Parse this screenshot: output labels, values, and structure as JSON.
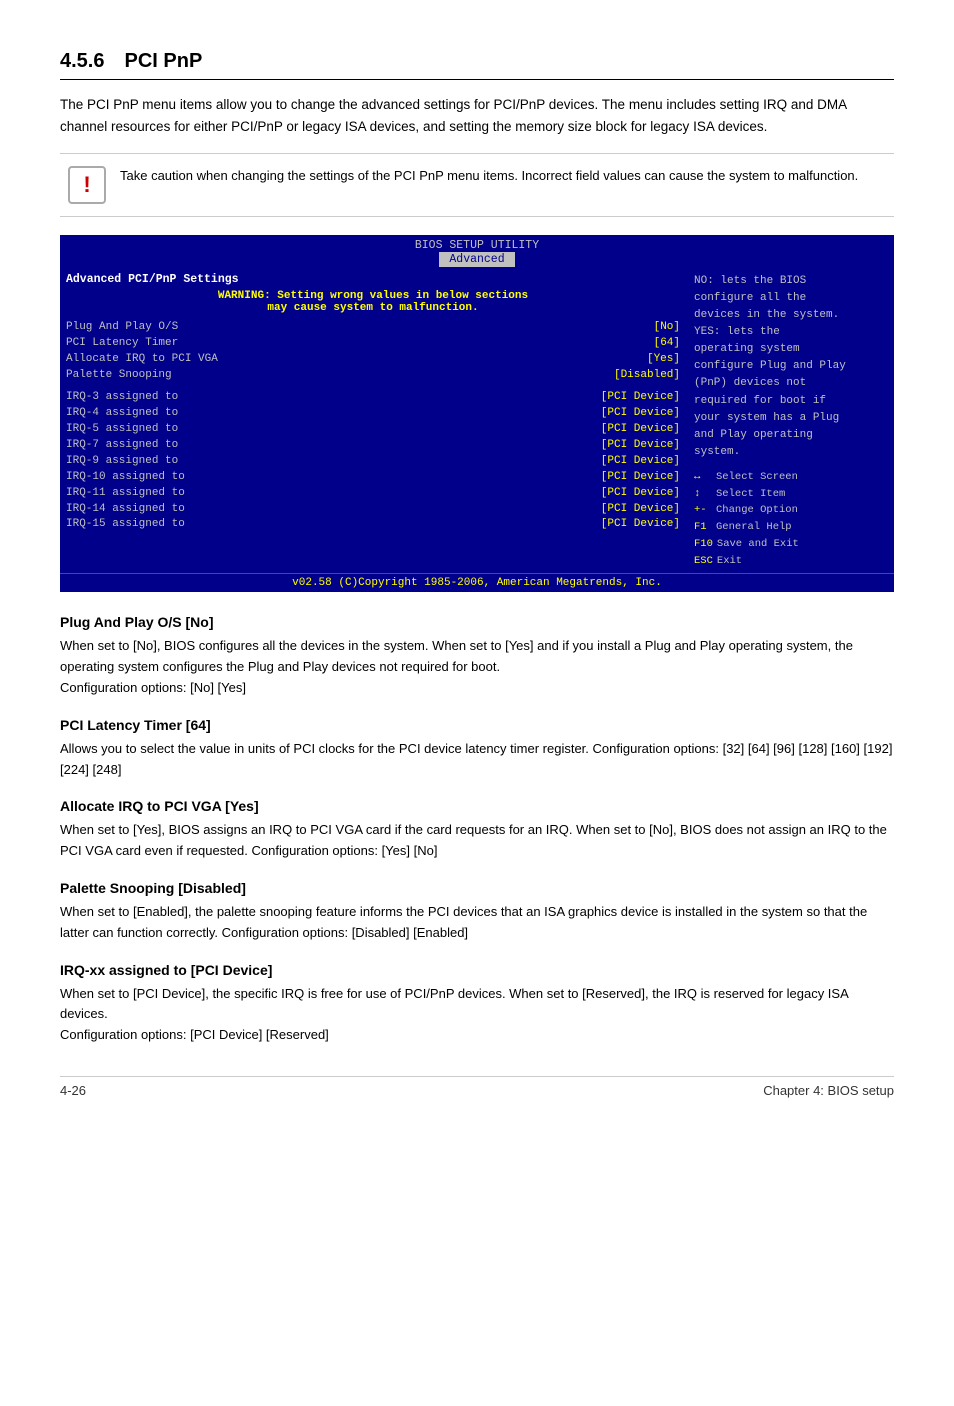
{
  "section": {
    "number": "4.5.6",
    "title": "PCI PnP",
    "intro": "The PCI PnP menu items allow you to change the advanced settings for PCI/PnP devices. The menu includes setting IRQ and DMA channel resources for either PCI/PnP or legacy ISA devices, and setting the memory size block for legacy ISA devices.",
    "warning": "Take caution when changing the settings of the PCI PnP menu items. Incorrect field values can cause the system to malfunction."
  },
  "bios": {
    "title": "BIOS SETUP UTILITY",
    "tab": "Advanced",
    "left": {
      "header": "Advanced PCI/PnP Settings",
      "warning_line1": "WARNING: Setting wrong values in below sections",
      "warning_line2": "may cause system to malfunction.",
      "settings": [
        {
          "key": "Plug And Play O/S",
          "value": "[No]"
        },
        {
          "key": "PCI Latency Timer",
          "value": "[64]"
        },
        {
          "key": "Allocate IRQ to PCI VGA",
          "value": "[Yes]"
        },
        {
          "key": "Palette Snooping",
          "value": "[Disabled]"
        }
      ],
      "irqs": [
        {
          "key": "IRQ-3  assigned to",
          "value": "[PCI Device]"
        },
        {
          "key": "IRQ-4  assigned to",
          "value": "[PCI Device]"
        },
        {
          "key": "IRQ-5  assigned to",
          "value": "[PCI Device]"
        },
        {
          "key": "IRQ-7  assigned to",
          "value": "[PCI Device]"
        },
        {
          "key": "IRQ-9  assigned to",
          "value": "[PCI Device]"
        },
        {
          "key": "IRQ-10 assigned to",
          "value": "[PCI Device]"
        },
        {
          "key": "IRQ-11 assigned to",
          "value": "[PCI Device]"
        },
        {
          "key": "IRQ-14 assigned to",
          "value": "[PCI Device]"
        },
        {
          "key": "IRQ-15 assigned to",
          "value": "[PCI Device]"
        }
      ]
    },
    "right": {
      "description_lines": [
        "NO: lets the BIOS",
        "configure all the",
        "devices in the system.",
        "YES: lets the",
        "operating system",
        "configure Plug and Play",
        "(PnP) devices not",
        "required for boot if",
        "your system has a Plug",
        "and Play operating",
        "system."
      ],
      "keys": [
        {
          "icon": "↔",
          "label": "Select Screen"
        },
        {
          "icon": "↕",
          "label": "Select Item"
        },
        {
          "icon": "+-",
          "label": "Change Option"
        },
        {
          "icon": "F1",
          "label": "General Help"
        },
        {
          "icon": "F10",
          "label": "Save and Exit"
        },
        {
          "icon": "ESC",
          "label": "Exit"
        }
      ]
    },
    "footer": "v02.58 (C)Copyright 1985-2006, American Megatrends, Inc."
  },
  "subsections": [
    {
      "id": "plug-and-play",
      "title": "Plug And Play O/S [No]",
      "body": "When set to [No], BIOS configures all the devices in the system. When set to [Yes] and if you install a Plug and Play operating system, the operating system configures the Plug and Play devices not required for boot.\nConfiguration options: [No] [Yes]"
    },
    {
      "id": "pci-latency-timer",
      "title": "PCI Latency Timer [64]",
      "body": "Allows you to select the value in units of PCI clocks for the PCI device latency timer register. Configuration options: [32] [64] [96] [128] [160] [192] [224] [248]"
    },
    {
      "id": "allocate-irq",
      "title": "Allocate IRQ to PCI VGA [Yes]",
      "body": "When set to [Yes], BIOS assigns an IRQ to PCI VGA card if the card requests for an IRQ. When set to [No], BIOS does not assign an IRQ to the PCI VGA card even if requested. Configuration options: [Yes] [No]"
    },
    {
      "id": "palette-snooping",
      "title": "Palette Snooping [Disabled]",
      "body": "When set to [Enabled], the palette snooping feature informs the PCI devices that an ISA graphics device is installed in the system so that the latter can function correctly. Configuration options: [Disabled] [Enabled]"
    },
    {
      "id": "irq-assigned",
      "title": "IRQ-xx assigned to [PCI Device]",
      "body": "When set to [PCI Device], the specific IRQ is free for use of PCI/PnP devices. When set to [Reserved], the IRQ is reserved for legacy ISA devices.\nConfiguration options: [PCI Device] [Reserved]"
    }
  ],
  "footer": {
    "left": "4-26",
    "right": "Chapter 4: BIOS setup"
  }
}
